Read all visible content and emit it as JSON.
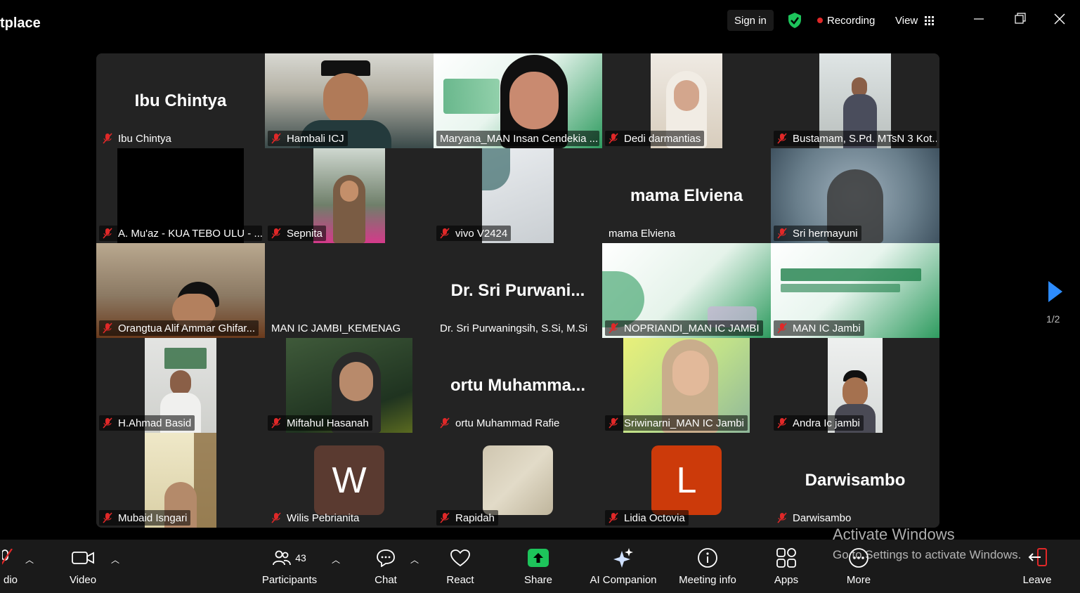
{
  "window": {
    "app_title": "tplace",
    "sign_in": "Sign in",
    "recording": "Recording",
    "view": "View"
  },
  "tiles": [
    {
      "display_name": "Ibu Chintya",
      "label": "Ibu Chintya"
    },
    {
      "label": "Hambali ICJ"
    },
    {
      "label": "Maryana_MAN Insan Cendekia ..."
    },
    {
      "label": "Dedi darmantias"
    },
    {
      "label": "Bustamam, S.Pd. MTsN 3 Kot..."
    },
    {
      "label": "A. Mu'az - KUA TEBO ULU - ..."
    },
    {
      "label": "Sepnita"
    },
    {
      "label": "vivo V2424"
    },
    {
      "display_name": "mama Elviena",
      "label": "mama Elviena"
    },
    {
      "label": "Sri hermayuni"
    },
    {
      "label": "Orangtua Alif Ammar Ghifar..."
    },
    {
      "label": "MAN IC JAMBI_KEMENAG"
    },
    {
      "display_name": "Dr. Sri Purwani...",
      "label": "Dr. Sri Purwaningsih, S.Si, M.Si"
    },
    {
      "label": "NOPRIANDI_MAN IC JAMBI"
    },
    {
      "label": "MAN IC Jambi"
    },
    {
      "label": "H.Ahmad Basid"
    },
    {
      "label": "Miftahul Hasanah"
    },
    {
      "display_name": "ortu Muhamma...",
      "label": "ortu Muhammad Rafie"
    },
    {
      "label": "Sriwinarni_MAN IC Jambi"
    },
    {
      "label": "Andra Ic jambi"
    },
    {
      "label": "Mubaid Isngari"
    },
    {
      "avatar_letter": "W",
      "label": "Wilis Pebrianita"
    },
    {
      "label": "Rapidah"
    },
    {
      "avatar_letter": "L",
      "label": "Lidia Octovia"
    },
    {
      "display_name": "Darwisambo",
      "label": "Darwisambo"
    }
  ],
  "pagination": "1/2",
  "toolbar": {
    "audio": "dio",
    "video": "Video",
    "participants": "Participants",
    "participants_count": "43",
    "chat": "Chat",
    "react": "React",
    "share": "Share",
    "ai_companion": "AI Companion",
    "meeting_info": "Meeting info",
    "apps": "Apps",
    "more": "More",
    "leave": "Leave"
  },
  "watermark": {
    "line1": "Activate Windows",
    "line2": "Go to Settings to activate Windows."
  },
  "colors": {
    "active_speaker": "#2ecc40",
    "share_green": "#1dc45b",
    "leave_red": "#e02828",
    "avatar_w": "#5a3a30",
    "avatar_l": "#cc3a0a",
    "next_arrow": "#2d8cff"
  }
}
